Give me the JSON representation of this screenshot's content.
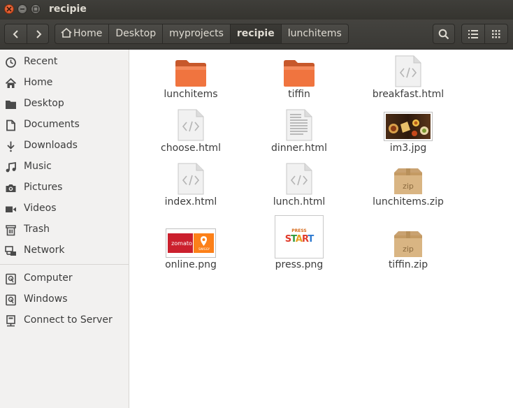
{
  "window": {
    "title": "recipie"
  },
  "breadcrumb": [
    "Home",
    "Desktop",
    "myprojects",
    "recipie",
    "lunchitems"
  ],
  "sidebar": {
    "places": [
      {
        "label": "Recent",
        "icon": "clock-icon"
      },
      {
        "label": "Home",
        "icon": "home-icon"
      },
      {
        "label": "Desktop",
        "icon": "folder-icon"
      },
      {
        "label": "Documents",
        "icon": "document-icon"
      },
      {
        "label": "Downloads",
        "icon": "download-icon"
      },
      {
        "label": "Music",
        "icon": "music-icon"
      },
      {
        "label": "Pictures",
        "icon": "camera-icon"
      },
      {
        "label": "Videos",
        "icon": "video-icon"
      },
      {
        "label": "Trash",
        "icon": "trash-icon"
      },
      {
        "label": "Network",
        "icon": "network-icon"
      }
    ],
    "devices": [
      {
        "label": "Computer",
        "icon": "drive-icon"
      },
      {
        "label": "Windows",
        "icon": "drive-icon"
      },
      {
        "label": "Connect to Server",
        "icon": "server-icon"
      }
    ]
  },
  "files": [
    {
      "name": "lunchitems",
      "type": "folder"
    },
    {
      "name": "tiffin",
      "type": "folder"
    },
    {
      "name": "breakfast.html",
      "type": "html"
    },
    {
      "name": "choose.html",
      "type": "html"
    },
    {
      "name": "dinner.html",
      "type": "text"
    },
    {
      "name": "im3.jpg",
      "type": "image-food"
    },
    {
      "name": "index.html",
      "type": "html"
    },
    {
      "name": "lunch.html",
      "type": "html"
    },
    {
      "name": "lunchitems.zip",
      "type": "zip"
    },
    {
      "name": "online.png",
      "type": "image-online",
      "thumb_text": [
        "zomato",
        "SWIGGY"
      ]
    },
    {
      "name": "press.png",
      "type": "image-press",
      "thumb_text": [
        "PRESS",
        "START"
      ]
    },
    {
      "name": "tiffin.zip",
      "type": "zip"
    }
  ],
  "colors": {
    "titlebar": "#3c3b37",
    "folder": "#f0743f",
    "accent": "#e95420",
    "zomato": "#cb202d",
    "swiggy": "#fc8019"
  }
}
